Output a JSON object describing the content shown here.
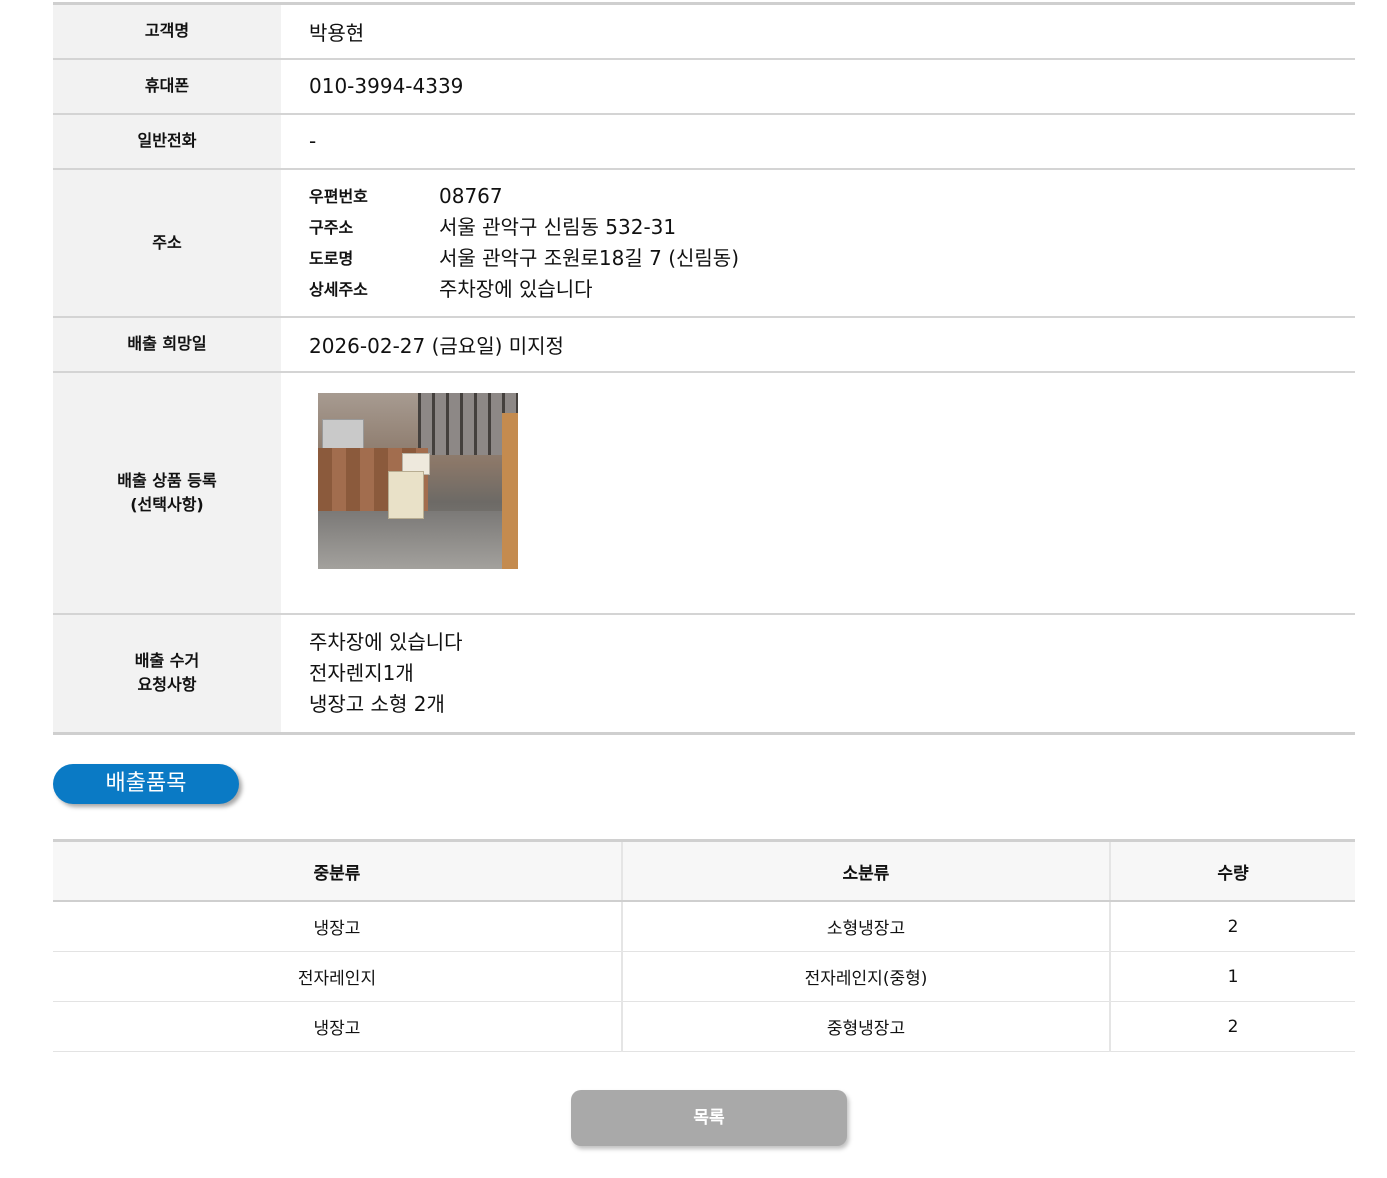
{
  "info": {
    "customer_label": "고객명",
    "customer_value": "박용현",
    "mobile_label": "휴대폰",
    "mobile_value": "010-3994-4339",
    "phone_label": "일반전화",
    "phone_value": "-",
    "address_label": "주소",
    "address": {
      "zip_label": "우편번호",
      "zip_value": "08767",
      "old_label": "구주소",
      "old_value": "서울 관악구 신림동 532-31",
      "road_label": "도로명",
      "road_value": "서울 관악구 조원로18길 7 (신림동)",
      "detail_label": "상세주소",
      "detail_value": "주차장에 있습니다"
    },
    "date_label": "배출 희망일",
    "date_value": "2026-02-27 (금요일) 미지정",
    "product_label_line1": "배출 상품 등록",
    "product_label_line2": "(선택사항)",
    "request_label_line1": "배출 수거",
    "request_label_line2": "요청사항",
    "request_lines": [
      "주차장에 있습니다",
      "전자렌지1개",
      "냉장고 소형 2개"
    ]
  },
  "section_title": "배출품목",
  "items_table": {
    "headers": [
      "중분류",
      "소분류",
      "수량"
    ],
    "rows": [
      [
        "냉장고",
        "소형냉장고",
        "2"
      ],
      [
        "전자레인지",
        "전자레인지(중형)",
        "1"
      ],
      [
        "냉장고",
        "중형냉장고",
        "2"
      ]
    ]
  },
  "list_button_label": "목록"
}
